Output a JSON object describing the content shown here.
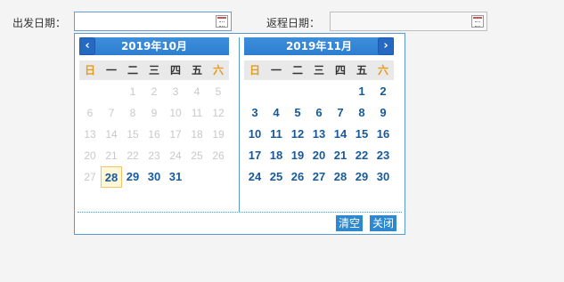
{
  "form": {
    "departure_label": "出发日期：",
    "departure_value": "",
    "return_label": "返程日期：",
    "return_value": ""
  },
  "picker": {
    "weekdays": [
      "日",
      "一",
      "二",
      "三",
      "四",
      "五",
      "六"
    ],
    "left": {
      "title": "2019年10月",
      "days": [
        [
          "",
          "",
          "1",
          "2",
          "3",
          "4",
          "5"
        ],
        [
          "6",
          "7",
          "8",
          "9",
          "10",
          "11",
          "12"
        ],
        [
          "13",
          "14",
          "15",
          "16",
          "17",
          "18",
          "19"
        ],
        [
          "20",
          "21",
          "22",
          "23",
          "24",
          "25",
          "26"
        ],
        [
          "27",
          "28",
          "29",
          "30",
          "31",
          "",
          ""
        ]
      ]
    },
    "right": {
      "title": "2019年11月",
      "days": [
        [
          "",
          "",
          "",
          "",
          "",
          "1",
          "2"
        ],
        [
          "3",
          "4",
          "5",
          "6",
          "7",
          "8",
          "9"
        ],
        [
          "10",
          "11",
          "12",
          "13",
          "14",
          "15",
          "16"
        ],
        [
          "17",
          "18",
          "19",
          "20",
          "21",
          "22",
          "23"
        ],
        [
          "24",
          "25",
          "26",
          "27",
          "28",
          "29",
          "30"
        ]
      ]
    },
    "clear_label": "清空",
    "close_label": "关闭",
    "colors": {
      "accent": "#2e88cf",
      "weekend": "#e89a1c",
      "active_day": "#165a9c",
      "disabled_day": "#c8c8c8"
    }
  }
}
